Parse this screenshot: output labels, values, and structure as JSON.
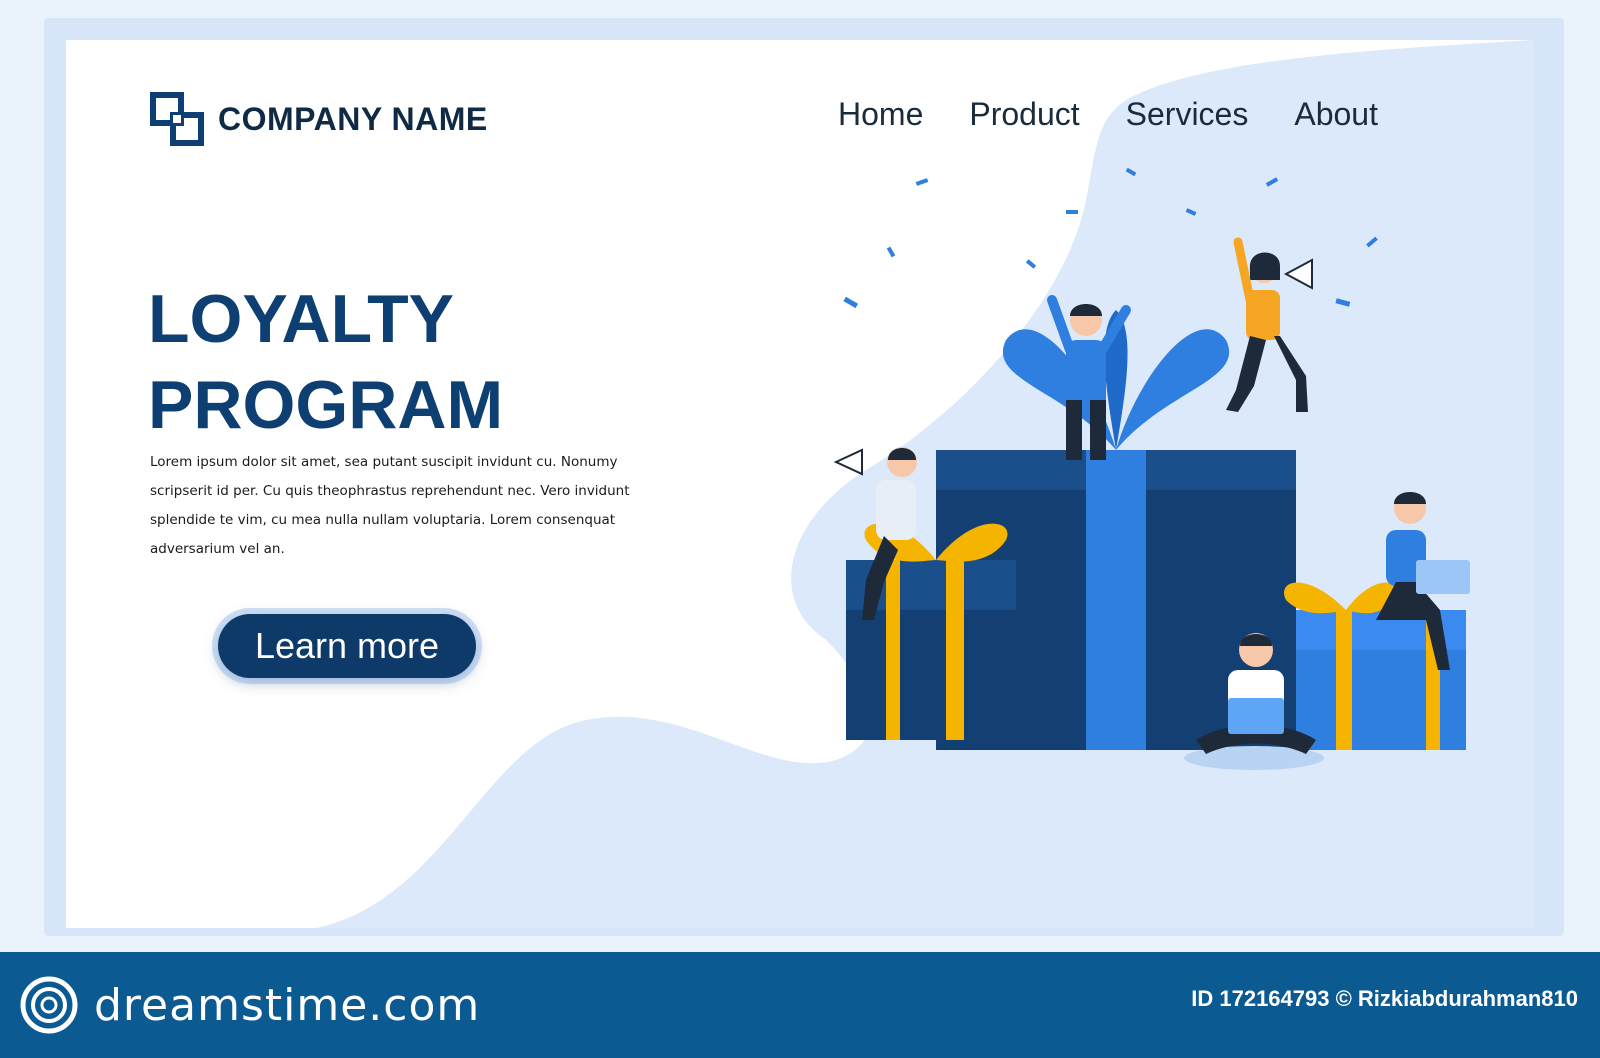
{
  "header": {
    "company_name": "COMPANY NAME",
    "nav": [
      "Home",
      "Product",
      "Services",
      "About"
    ]
  },
  "hero": {
    "title_line1": "LOYALTY",
    "title_line2": "PROGRAM",
    "body": "Lorem ipsum dolor sit amet, sea putant suscipit invidunt cu. Nonumy scripserit id per. Cu quis theophrastus reprehendunt nec. Vero invidunt splendide te vim, cu mea nulla nullam voluptaria. Lorem consenquat adversarium vel an.",
    "cta_label": "Learn more"
  },
  "footer": {
    "brand": "dreamstime.com",
    "credit": "ID 172164793 © Rizkiabdurahman810"
  },
  "colors": {
    "primary_dark": "#0e3a6a",
    "accent_blue": "#2f7fe0",
    "gift_dark": "#143f73",
    "ribbon_gold": "#f4b400",
    "shirt_orange": "#f6a623",
    "footer_blue": "#0c5a92",
    "bg_light": "#dce9fb"
  },
  "icons": [
    "logo-mark-icon",
    "megaphone-icon",
    "laptop-icon",
    "dreamstime-logo-icon"
  ]
}
